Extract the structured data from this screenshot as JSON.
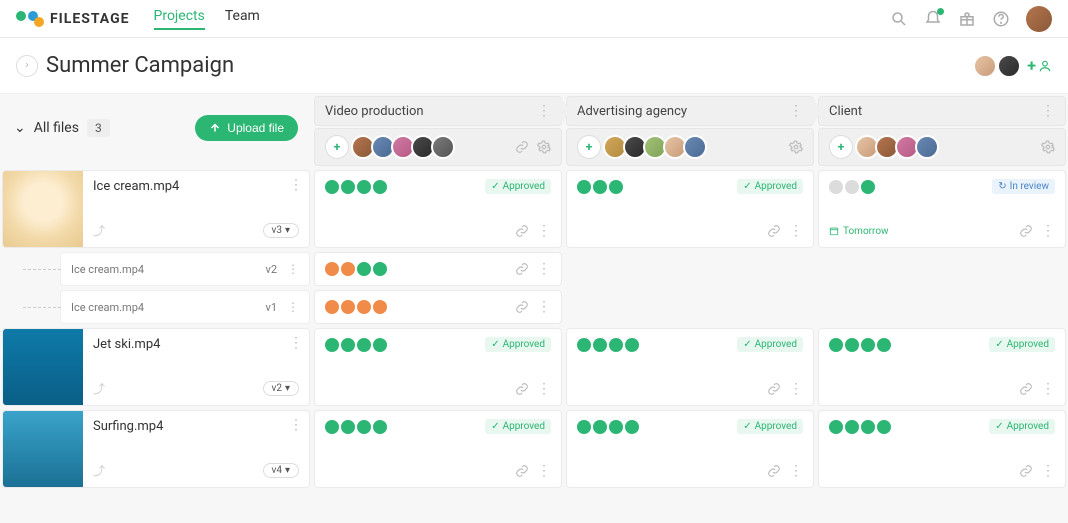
{
  "brand": "FILESTAGE",
  "nav": {
    "projects": "Projects",
    "team": "Team"
  },
  "icons": {
    "search": "search",
    "bell": "bell",
    "gift": "gift",
    "help": "help"
  },
  "project": {
    "title": "Summer Campaign"
  },
  "sidebar": {
    "all_files": "All files",
    "count": "3",
    "upload": "Upload file"
  },
  "stages": [
    {
      "name": "Video production"
    },
    {
      "name": "Advertising agency"
    },
    {
      "name": "Client"
    }
  ],
  "status": {
    "approved": "Approved",
    "in_review": "In review",
    "due_tomorrow": "Tomorrow"
  },
  "files": [
    {
      "name": "Ice cream.mp4",
      "version": "v3",
      "subversions": [
        {
          "name": "Ice cream.mp4",
          "v": "v2"
        },
        {
          "name": "Ice cream.mp4",
          "v": "v1"
        }
      ]
    },
    {
      "name": "Jet ski.mp4",
      "version": "v2"
    },
    {
      "name": "Surfing.mp4",
      "version": "v4"
    }
  ]
}
